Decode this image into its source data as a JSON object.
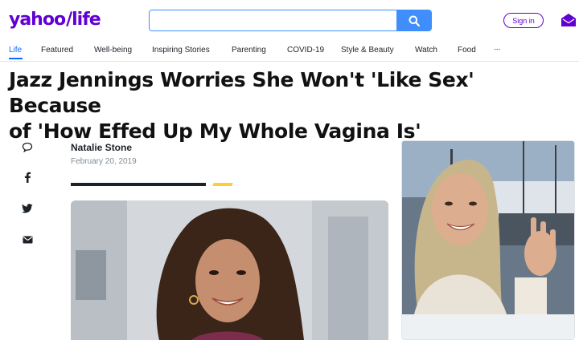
{
  "header": {
    "logo_yahoo": "yahoo",
    "logo_slash": "/",
    "logo_life": "life",
    "search_value": "",
    "search_placeholder": "",
    "signin_label": "Sign in"
  },
  "nav": {
    "items": [
      {
        "label": "Life",
        "active": true
      },
      {
        "label": "Featured"
      },
      {
        "label": "Well-being"
      },
      {
        "label": "Inspiring Stories"
      },
      {
        "label": "Parenting"
      },
      {
        "label": "COVID-19"
      },
      {
        "label": "Style & Beauty"
      },
      {
        "label": "Watch"
      },
      {
        "label": "Food"
      },
      {
        "label": "..."
      }
    ]
  },
  "article": {
    "headline_line1": "Jazz Jennings Worries She Won't 'Like Sex' Because",
    "headline_line2": "of 'How Effed Up My Whole Vagina Is'",
    "author": "Natalie Stone",
    "date": "February 20, 2019"
  },
  "colors": {
    "brand": "#6001d2",
    "search_blue": "#3f8efc",
    "nav_active": "#0f69ff",
    "accent_yellow": "#ffcd36"
  },
  "icons": [
    "search-icon",
    "mail-icon",
    "comment-icon",
    "facebook-icon",
    "twitter-icon",
    "email-icon"
  ]
}
